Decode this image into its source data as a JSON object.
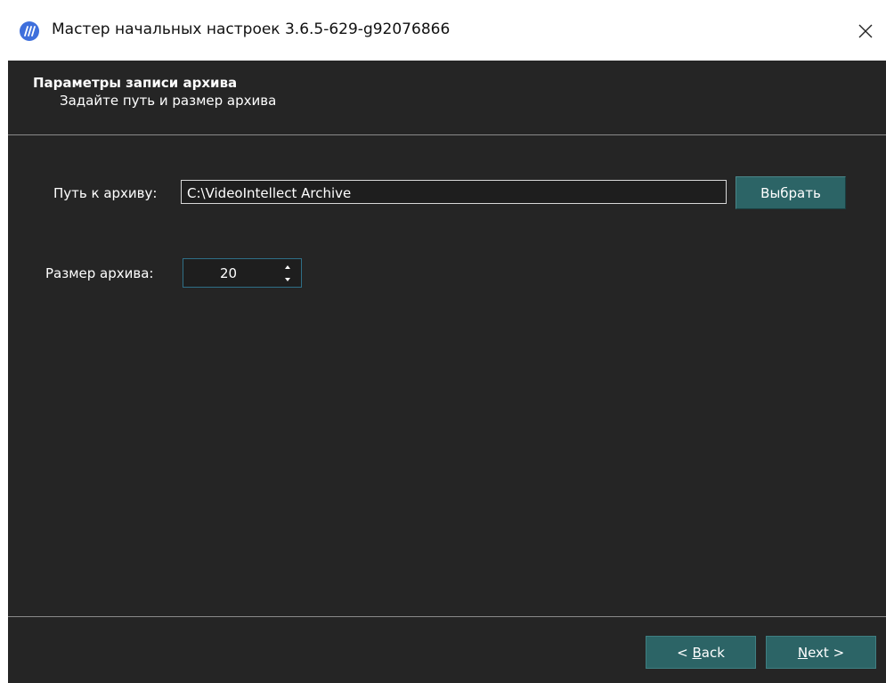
{
  "window": {
    "title": "Мастер начальных настроек 3.6.5-629-g92076866",
    "app_icon": "app-logo-icon",
    "close_icon": "close-icon"
  },
  "header": {
    "title": "Параметры записи архива",
    "subtitle": "Задайте путь и размер архива"
  },
  "form": {
    "path_label": "Путь к архиву:",
    "path_value": "C:\\VideoIntellect Archive",
    "browse_button": "Выбрать",
    "size_label": "Размер архива:",
    "size_value": "20"
  },
  "footer": {
    "back_prefix": "< ",
    "back_mnemonic": "B",
    "back_rest": "ack",
    "next_mnemonic": "N",
    "next_rest": "ext >"
  },
  "colors": {
    "background": "#252525",
    "button": "#2c6466",
    "accent_border": "#2f6f87",
    "app_icon": "#3e6fdc"
  }
}
